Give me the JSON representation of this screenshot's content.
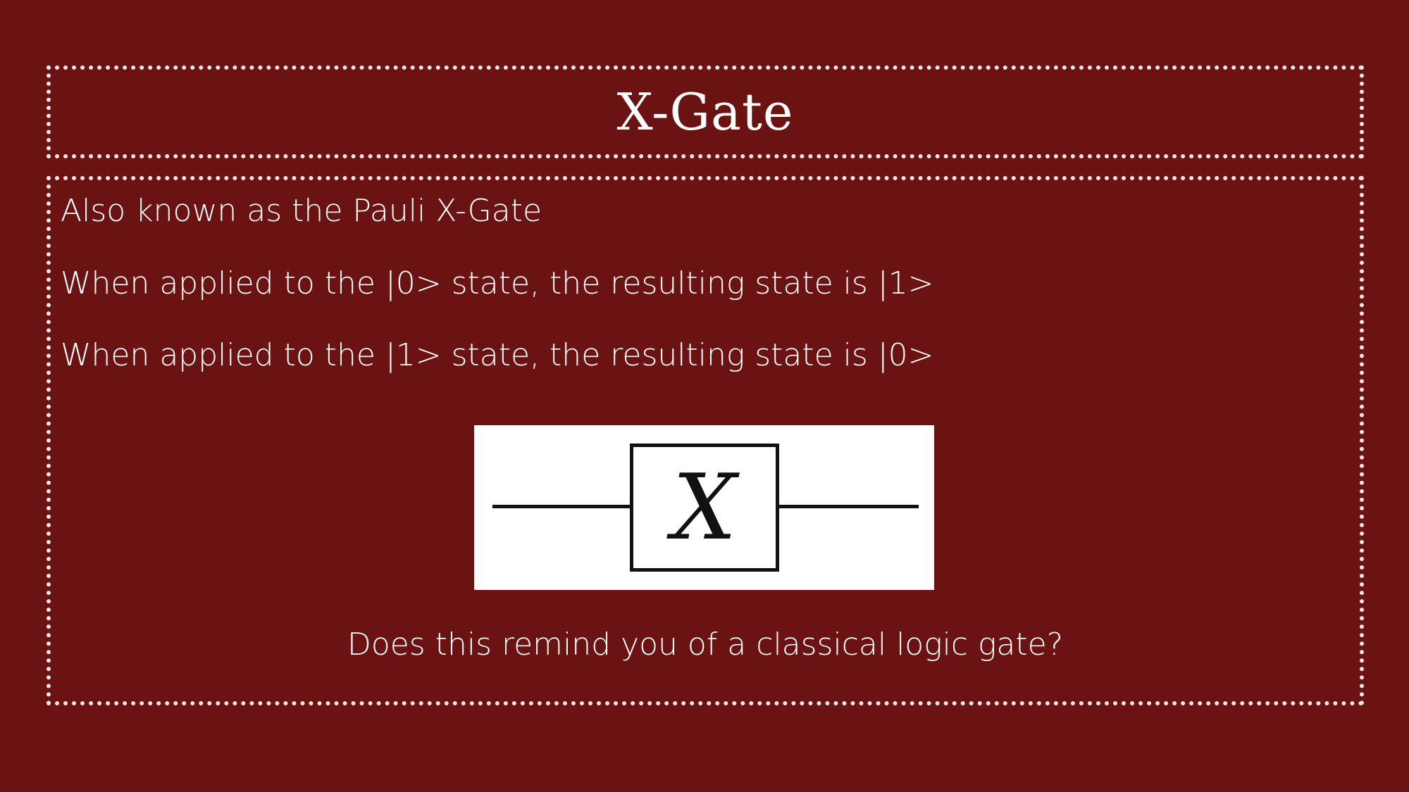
{
  "slide": {
    "title": "X-Gate",
    "bullets": [
      "Also known as the Pauli X-Gate",
      "When applied to the |0> state, the resulting state is |1>",
      "When applied to the |1> state, the resulting state is |0>"
    ],
    "diagram": {
      "gate_label": "X"
    },
    "caption": "Does this remind you of a classical logic gate?"
  },
  "colors": {
    "background": "#6b1212",
    "text": "#ffffff",
    "frame": "#ffffff"
  }
}
